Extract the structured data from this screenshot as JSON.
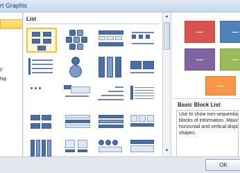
{
  "window": {
    "title": "rt Graphic"
  },
  "left_pane": {
    "items": [
      {
        "label": "",
        "selected": true
      },
      {
        "label": "y",
        "selected": false
      },
      {
        "label": "hip",
        "selected": false
      }
    ]
  },
  "gallery": {
    "heading": "List",
    "selected_layout": "Basic Block List"
  },
  "preview": {
    "layout_name": "Basic Block List",
    "description_lines": [
      "Use to show non-sequential o",
      "blocks of information. Maximi",
      "horizontal and vertical display",
      "shapes."
    ],
    "block_colors": [
      "#d9534f",
      "#4f81bd",
      "#8064a2",
      "#9bbb59",
      "#f79646"
    ]
  },
  "footer": {
    "ok_label": "OK"
  }
}
